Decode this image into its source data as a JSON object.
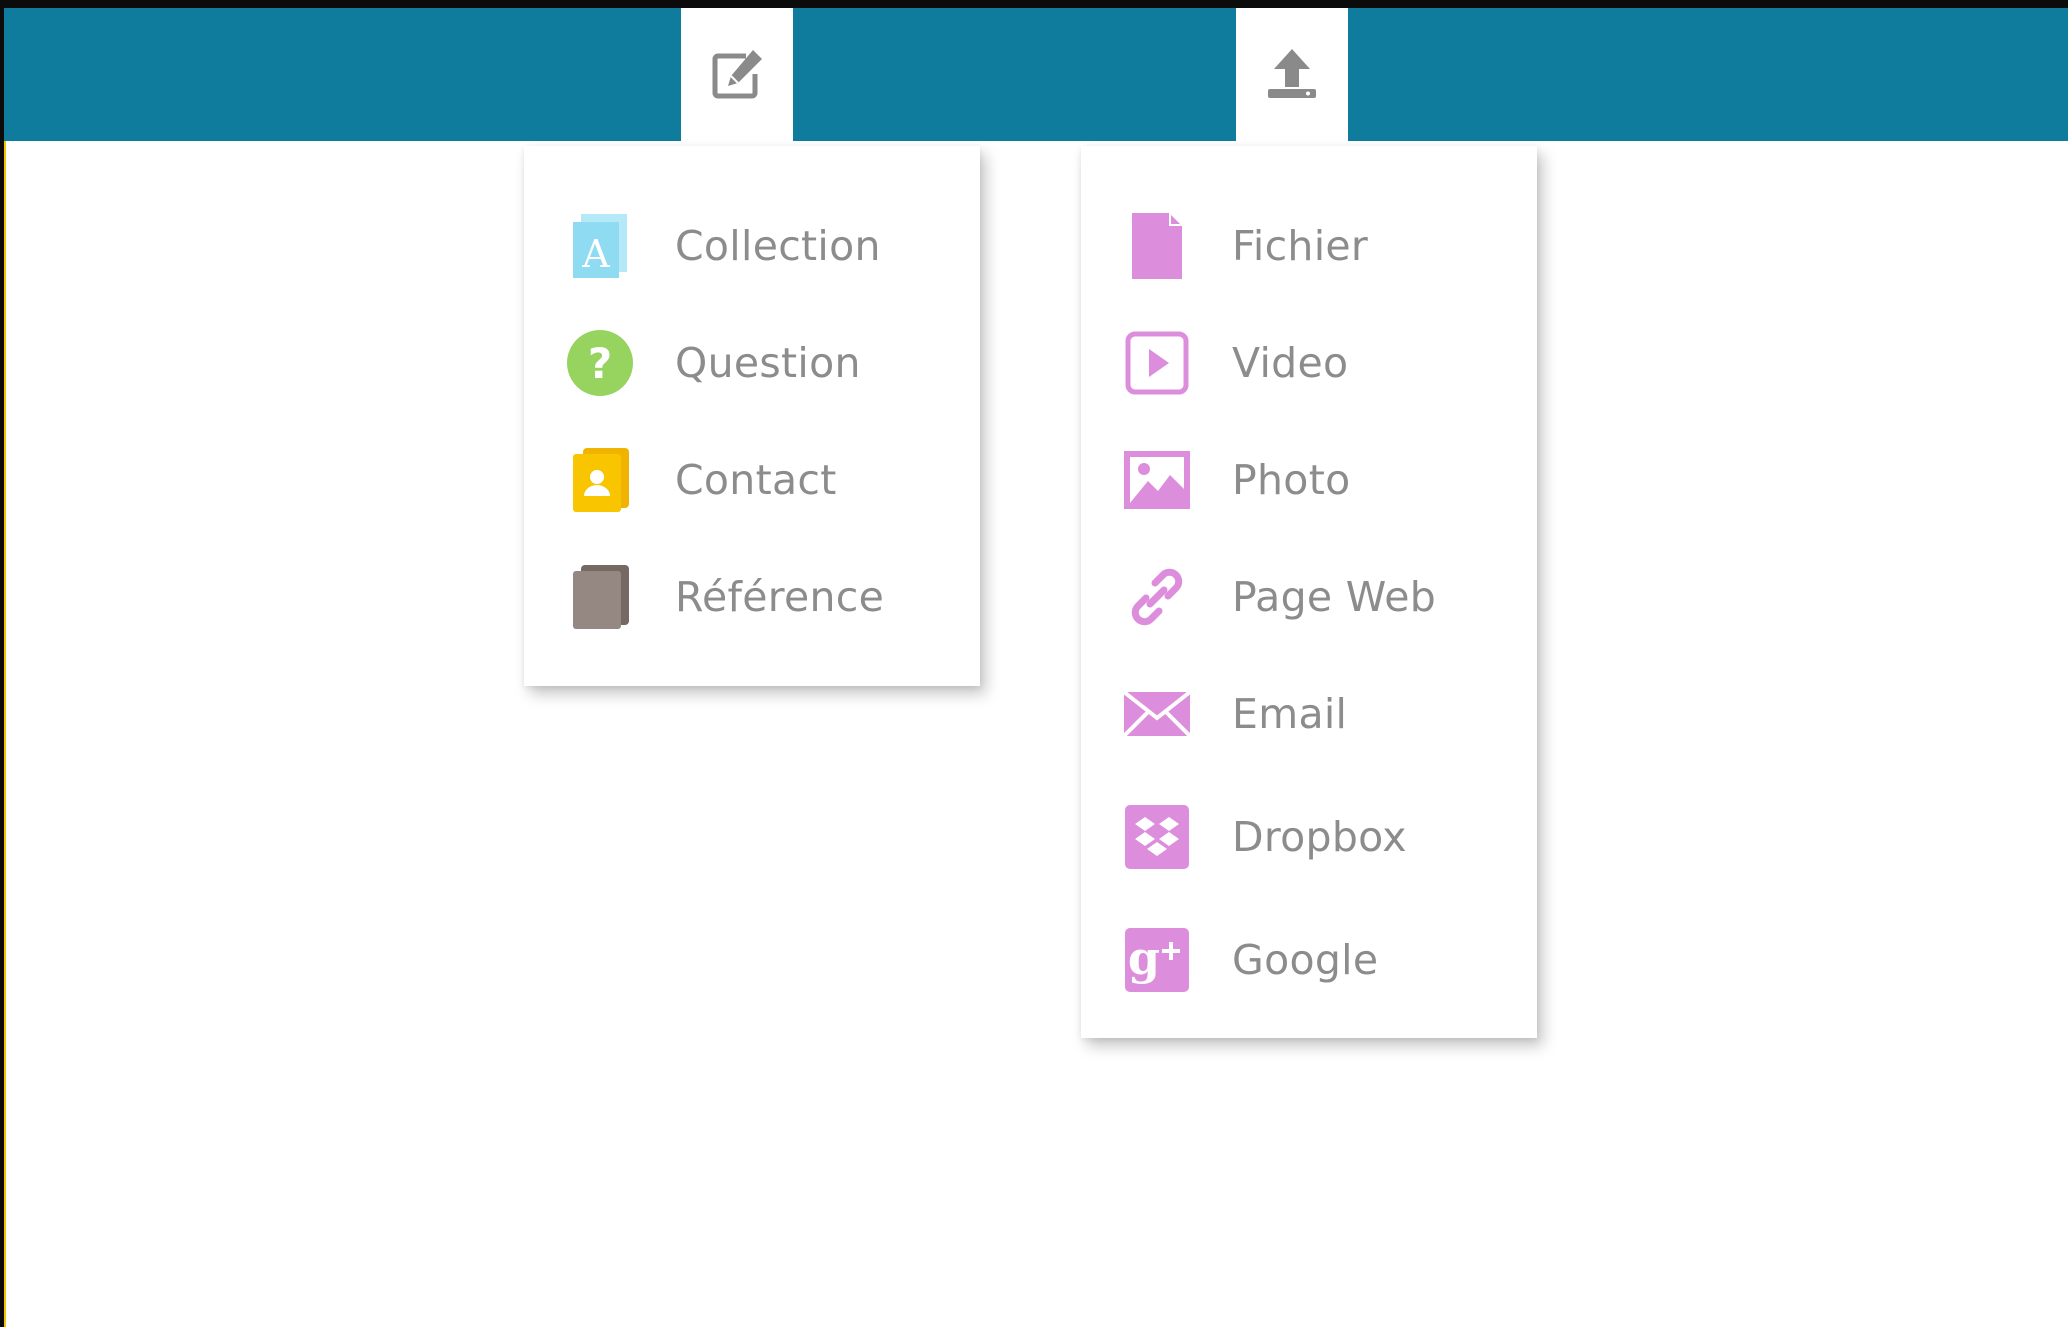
{
  "toolbar": {
    "color": "#0f7b9d",
    "tabs": [
      {
        "icon": "edit-icon"
      },
      {
        "icon": "upload-icon"
      }
    ]
  },
  "create_menu": {
    "items": [
      {
        "label": "Collection",
        "icon": "collection-icon",
        "color": "#8fdcf2"
      },
      {
        "label": "Question",
        "icon": "question-icon",
        "color": "#96d35f"
      },
      {
        "label": "Contact",
        "icon": "contact-icon",
        "color": "#f9c400"
      },
      {
        "label": "Référence",
        "icon": "reference-icon",
        "color": "#958781"
      }
    ]
  },
  "upload_menu": {
    "accent": "#dc8ddc",
    "items": [
      {
        "label": "Fichier",
        "icon": "file-icon"
      },
      {
        "label": "Video",
        "icon": "video-icon"
      },
      {
        "label": "Photo",
        "icon": "photo-icon"
      },
      {
        "label": "Page Web",
        "icon": "link-icon"
      },
      {
        "label": "Email",
        "icon": "email-icon"
      },
      {
        "label": "Dropbox",
        "icon": "dropbox-icon"
      },
      {
        "label": "Google",
        "icon": "google-plus-icon"
      }
    ]
  }
}
